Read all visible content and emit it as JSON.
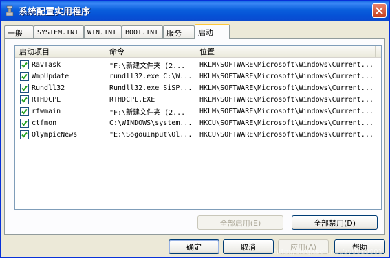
{
  "window": {
    "title": "系统配置实用程序"
  },
  "tabs": [
    {
      "label": "一般"
    },
    {
      "label": "SYSTEM.INI"
    },
    {
      "label": "WIN.INI"
    },
    {
      "label": "BOOT.INI"
    },
    {
      "label": "服务"
    },
    {
      "label": "启动"
    }
  ],
  "listview": {
    "columns": [
      "启动项目",
      "命令",
      "位置"
    ],
    "rows": [
      {
        "checked": true,
        "item": "RavTask",
        "command": "\"F:\\新建文件夹 (2...",
        "location": "HKLM\\SOFTWARE\\Microsoft\\Windows\\Current..."
      },
      {
        "checked": true,
        "item": "WmpUpdate",
        "command": "rundll32.exe C:\\W...",
        "location": "HKLM\\SOFTWARE\\Microsoft\\Windows\\Current..."
      },
      {
        "checked": true,
        "item": "Rundll32",
        "command": "Rundll32.exe SiSP...",
        "location": "HKLM\\SOFTWARE\\Microsoft\\Windows\\Current..."
      },
      {
        "checked": true,
        "item": "RTHDCPL",
        "command": "RTHDCPL.EXE",
        "location": "HKLM\\SOFTWARE\\Microsoft\\Windows\\Current..."
      },
      {
        "checked": true,
        "item": "rfwmain",
        "command": "\"F:\\新建文件夹 (2...",
        "location": "HKLM\\SOFTWARE\\Microsoft\\Windows\\Current..."
      },
      {
        "checked": true,
        "item": "ctfmon",
        "command": "C:\\WINDOWS\\system...",
        "location": "HKCU\\SOFTWARE\\Microsoft\\Windows\\Current..."
      },
      {
        "checked": true,
        "item": "OlympicNews",
        "command": "\"E:\\SogouInput\\Ol...",
        "location": "HKCU\\SOFTWARE\\Microsoft\\Windows\\Current..."
      }
    ]
  },
  "buttons": {
    "enable_all": "全部启用(E)",
    "disable_all": "全部禁用(D)",
    "ok": "确定",
    "cancel": "取消",
    "apply": "应用(A)",
    "help": "帮助"
  },
  "watermark": "http://blog.csdn.net/zy0010001",
  "colors": {
    "titlebar": "#0a5fdc",
    "active_tab_accent": "#ffc83c",
    "checkmark": "#21a121",
    "close_button": "#c6401d"
  }
}
